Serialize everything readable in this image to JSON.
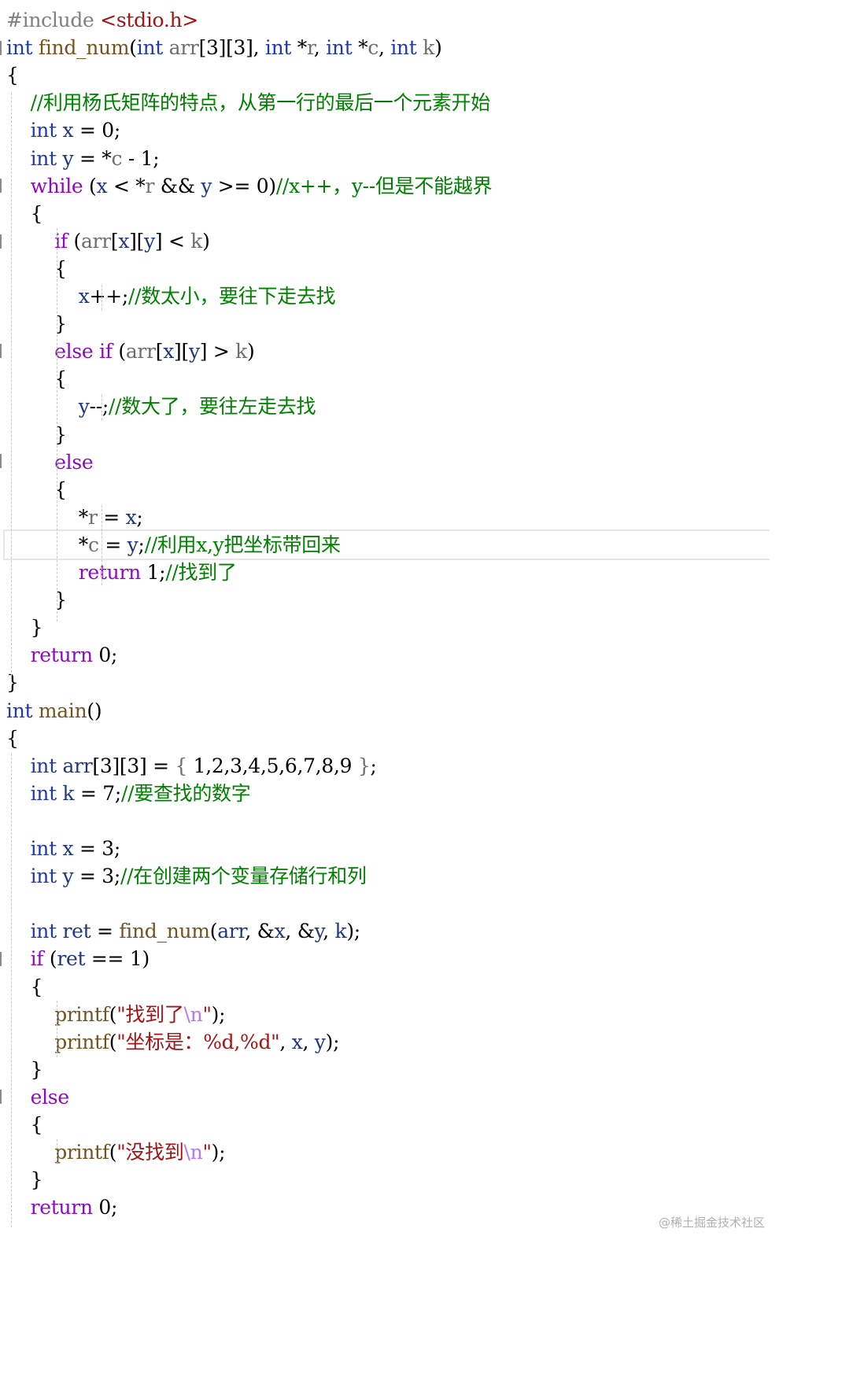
{
  "editor": {
    "language": "C",
    "watermark": "@稀土掘金技术社区",
    "lines": [
      [
        {
          "t": "#include ",
          "c": "pp"
        },
        {
          "t": "<stdio.h>",
          "c": "str"
        }
      ],
      [
        {
          "t": "int",
          "c": "kw"
        },
        {
          "t": " ",
          "c": "t"
        },
        {
          "t": "find_num",
          "c": "fn"
        },
        {
          "t": "(",
          "c": "op"
        },
        {
          "t": "int",
          "c": "kw"
        },
        {
          "t": " arr",
          "c": "p"
        },
        {
          "t": "[3][3], ",
          "c": "op"
        },
        {
          "t": "int",
          "c": "kw"
        },
        {
          "t": " *",
          "c": "op"
        },
        {
          "t": "r",
          "c": "p"
        },
        {
          "t": ", ",
          "c": "op"
        },
        {
          "t": "int",
          "c": "kw"
        },
        {
          "t": " *",
          "c": "op"
        },
        {
          "t": "c",
          "c": "p"
        },
        {
          "t": ", ",
          "c": "op"
        },
        {
          "t": "int",
          "c": "kw"
        },
        {
          "t": " k",
          "c": "p"
        },
        {
          "t": ")",
          "c": "op"
        }
      ],
      [
        {
          "t": "{",
          "c": "op"
        }
      ],
      [
        {
          "t": "    ",
          "c": "t"
        },
        {
          "t": "//利用杨氏矩阵的特点，从第一行的最后一个元素开始",
          "c": "cm"
        }
      ],
      [
        {
          "t": "    ",
          "c": "t"
        },
        {
          "t": "int",
          "c": "kw"
        },
        {
          "t": " x",
          "c": "id"
        },
        {
          "t": " = 0;",
          "c": "op"
        }
      ],
      [
        {
          "t": "    ",
          "c": "t"
        },
        {
          "t": "int",
          "c": "kw"
        },
        {
          "t": " y",
          "c": "id"
        },
        {
          "t": " = *",
          "c": "op"
        },
        {
          "t": "c",
          "c": "p"
        },
        {
          "t": " - 1;",
          "c": "op"
        }
      ],
      [
        {
          "t": "    ",
          "c": "t"
        },
        {
          "t": "while",
          "c": "kw2"
        },
        {
          "t": " (",
          "c": "op"
        },
        {
          "t": "x",
          "c": "id"
        },
        {
          "t": " < *",
          "c": "op"
        },
        {
          "t": "r",
          "c": "p"
        },
        {
          "t": " && ",
          "c": "op"
        },
        {
          "t": "y",
          "c": "id"
        },
        {
          "t": " >= 0)",
          "c": "op"
        },
        {
          "t": "//x++，y--但是不能越界",
          "c": "cm"
        }
      ],
      [
        {
          "t": "    {",
          "c": "op"
        }
      ],
      [
        {
          "t": "        ",
          "c": "t"
        },
        {
          "t": "if",
          "c": "kw2"
        },
        {
          "t": " (",
          "c": "op"
        },
        {
          "t": "arr",
          "c": "p"
        },
        {
          "t": "[",
          "c": "op"
        },
        {
          "t": "x",
          "c": "id"
        },
        {
          "t": "][",
          "c": "op"
        },
        {
          "t": "y",
          "c": "id"
        },
        {
          "t": "] < ",
          "c": "op"
        },
        {
          "t": "k",
          "c": "p"
        },
        {
          "t": ")",
          "c": "op"
        }
      ],
      [
        {
          "t": "        {",
          "c": "op"
        }
      ],
      [
        {
          "t": "            ",
          "c": "t"
        },
        {
          "t": "x",
          "c": "id"
        },
        {
          "t": "++;",
          "c": "op"
        },
        {
          "t": "//数太小，要往下走去找",
          "c": "cm"
        }
      ],
      [
        {
          "t": "        }",
          "c": "op"
        }
      ],
      [
        {
          "t": "        ",
          "c": "t"
        },
        {
          "t": "else",
          "c": "kw2"
        },
        {
          "t": " ",
          "c": "t"
        },
        {
          "t": "if",
          "c": "kw2"
        },
        {
          "t": " (",
          "c": "op"
        },
        {
          "t": "arr",
          "c": "p"
        },
        {
          "t": "[",
          "c": "op"
        },
        {
          "t": "x",
          "c": "id"
        },
        {
          "t": "][",
          "c": "op"
        },
        {
          "t": "y",
          "c": "id"
        },
        {
          "t": "] > ",
          "c": "op"
        },
        {
          "t": "k",
          "c": "p"
        },
        {
          "t": ")",
          "c": "op"
        }
      ],
      [
        {
          "t": "        {",
          "c": "op"
        }
      ],
      [
        {
          "t": "            ",
          "c": "t"
        },
        {
          "t": "y",
          "c": "id"
        },
        {
          "t": "--;",
          "c": "op"
        },
        {
          "t": "//数大了，要往左走去找",
          "c": "cm"
        }
      ],
      [
        {
          "t": "        }",
          "c": "op"
        }
      ],
      [
        {
          "t": "        ",
          "c": "t"
        },
        {
          "t": "else",
          "c": "kw2"
        }
      ],
      [
        {
          "t": "        {",
          "c": "op"
        }
      ],
      [
        {
          "t": "            *",
          "c": "op"
        },
        {
          "t": "r",
          "c": "p"
        },
        {
          "t": " = ",
          "c": "op"
        },
        {
          "t": "x",
          "c": "id"
        },
        {
          "t": ";",
          "c": "op"
        }
      ],
      [
        {
          "t": "            *",
          "c": "op"
        },
        {
          "t": "c",
          "c": "p"
        },
        {
          "t": " = ",
          "c": "op"
        },
        {
          "t": "y",
          "c": "id"
        },
        {
          "t": ";",
          "c": "op"
        },
        {
          "t": "//利用x,y把坐标带回来",
          "c": "cm"
        }
      ],
      [
        {
          "t": "            ",
          "c": "t"
        },
        {
          "t": "return",
          "c": "kw2"
        },
        {
          "t": " 1;",
          "c": "op"
        },
        {
          "t": "//找到了",
          "c": "cm"
        }
      ],
      [
        {
          "t": "        }",
          "c": "op"
        }
      ],
      [
        {
          "t": "    }",
          "c": "op"
        }
      ],
      [
        {
          "t": "    ",
          "c": "t"
        },
        {
          "t": "return",
          "c": "kw2"
        },
        {
          "t": " 0;",
          "c": "op"
        }
      ],
      [
        {
          "t": "}",
          "c": "op"
        }
      ],
      [
        {
          "t": "int",
          "c": "kw"
        },
        {
          "t": " ",
          "c": "t"
        },
        {
          "t": "main",
          "c": "fn"
        },
        {
          "t": "()",
          "c": "op"
        }
      ],
      [
        {
          "t": "{",
          "c": "op"
        }
      ],
      [
        {
          "t": "    ",
          "c": "t"
        },
        {
          "t": "int",
          "c": "kw"
        },
        {
          "t": " arr",
          "c": "id"
        },
        {
          "t": "[3][3] = ",
          "c": "op"
        },
        {
          "t": "{",
          "c": "p"
        },
        {
          "t": " 1,2,3,4,5,6,7,8,9 ",
          "c": "op"
        },
        {
          "t": "}",
          "c": "p"
        },
        {
          "t": ";",
          "c": "op"
        }
      ],
      [
        {
          "t": "    ",
          "c": "t"
        },
        {
          "t": "int",
          "c": "kw"
        },
        {
          "t": " k",
          "c": "id"
        },
        {
          "t": " = 7;",
          "c": "op"
        },
        {
          "t": "//要查找的数字",
          "c": "cm"
        }
      ],
      [],
      [
        {
          "t": "    ",
          "c": "t"
        },
        {
          "t": "int",
          "c": "kw"
        },
        {
          "t": " x",
          "c": "id"
        },
        {
          "t": " = 3;",
          "c": "op"
        }
      ],
      [
        {
          "t": "    ",
          "c": "t"
        },
        {
          "t": "int",
          "c": "kw"
        },
        {
          "t": " y",
          "c": "id"
        },
        {
          "t": " = 3;",
          "c": "op"
        },
        {
          "t": "//在创建两个变量存储行和列",
          "c": "cm"
        }
      ],
      [],
      [
        {
          "t": "    ",
          "c": "t"
        },
        {
          "t": "int",
          "c": "kw"
        },
        {
          "t": " ret",
          "c": "id"
        },
        {
          "t": " = ",
          "c": "op"
        },
        {
          "t": "find_num",
          "c": "fn"
        },
        {
          "t": "(",
          "c": "op"
        },
        {
          "t": "arr",
          "c": "id"
        },
        {
          "t": ", &",
          "c": "op"
        },
        {
          "t": "x",
          "c": "id"
        },
        {
          "t": ", &",
          "c": "op"
        },
        {
          "t": "y",
          "c": "id"
        },
        {
          "t": ", ",
          "c": "op"
        },
        {
          "t": "k",
          "c": "id"
        },
        {
          "t": ");",
          "c": "op"
        }
      ],
      [
        {
          "t": "    ",
          "c": "t"
        },
        {
          "t": "if",
          "c": "kw2"
        },
        {
          "t": " (",
          "c": "op"
        },
        {
          "t": "ret",
          "c": "id"
        },
        {
          "t": " == 1)",
          "c": "op"
        }
      ],
      [
        {
          "t": "    {",
          "c": "op"
        }
      ],
      [
        {
          "t": "        ",
          "c": "t"
        },
        {
          "t": "printf",
          "c": "fn"
        },
        {
          "t": "(",
          "c": "op"
        },
        {
          "t": "\"找到了",
          "c": "str"
        },
        {
          "t": "\\n",
          "c": "esc"
        },
        {
          "t": "\"",
          "c": "str"
        },
        {
          "t": ");",
          "c": "op"
        }
      ],
      [
        {
          "t": "        ",
          "c": "t"
        },
        {
          "t": "printf",
          "c": "fn"
        },
        {
          "t": "(",
          "c": "op"
        },
        {
          "t": "\"坐标是：%d,%d\"",
          "c": "str"
        },
        {
          "t": ", ",
          "c": "op"
        },
        {
          "t": "x",
          "c": "id"
        },
        {
          "t": ", ",
          "c": "op"
        },
        {
          "t": "y",
          "c": "id"
        },
        {
          "t": ");",
          "c": "op"
        }
      ],
      [
        {
          "t": "    }",
          "c": "op"
        }
      ],
      [
        {
          "t": "    ",
          "c": "t"
        },
        {
          "t": "else",
          "c": "kw2"
        }
      ],
      [
        {
          "t": "    {",
          "c": "op"
        }
      ],
      [
        {
          "t": "        ",
          "c": "t"
        },
        {
          "t": "printf",
          "c": "fn"
        },
        {
          "t": "(",
          "c": "op"
        },
        {
          "t": "\"没找到",
          "c": "str"
        },
        {
          "t": "\\n",
          "c": "esc"
        },
        {
          "t": "\"",
          "c": "str"
        },
        {
          "t": ");",
          "c": "op"
        }
      ],
      [
        {
          "t": "    }",
          "c": "op"
        }
      ],
      [
        {
          "t": "    ",
          "c": "t"
        },
        {
          "t": "return",
          "c": "kw2"
        },
        {
          "t": " 0;",
          "c": "op"
        }
      ]
    ]
  }
}
